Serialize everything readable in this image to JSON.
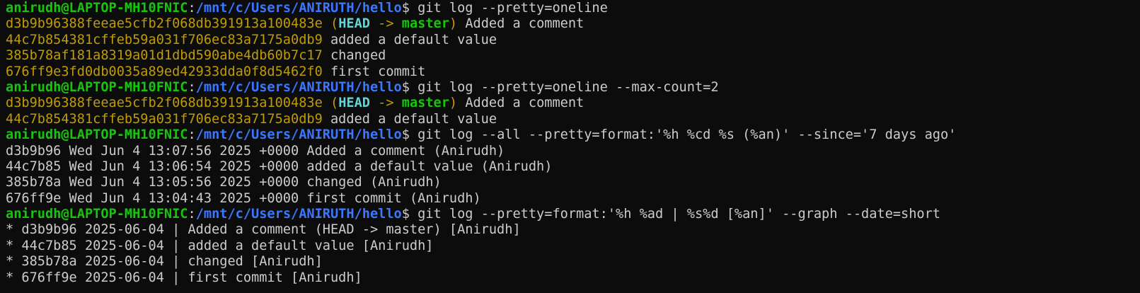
{
  "terminal": {
    "colors": {
      "background": "#0c0c0c",
      "text": "#cccccc",
      "prompt_user": "#16c60c",
      "prompt_path": "#3b78ff",
      "commit_hash": "#c19c00",
      "head_ref": "#61d6d6",
      "branch": "#16c60c"
    },
    "lines": [
      [
        {
          "cls": "user",
          "t": "anirudh@LAPTOP-MH10FNIC"
        },
        {
          "cls": "dollar",
          "t": ":"
        },
        {
          "cls": "path",
          "t": "/mnt/c/Users/ANIRUTH/hello"
        },
        {
          "cls": "dollar",
          "t": "$ "
        },
        {
          "cls": "cmd",
          "t": "git log --pretty=oneline"
        }
      ],
      [
        {
          "cls": "hash",
          "t": "d3b9b96388feeae5cfb2f068db391913a100483e"
        },
        {
          "cls": "text",
          "t": " "
        },
        {
          "cls": "paren",
          "t": "("
        },
        {
          "cls": "head",
          "t": "HEAD"
        },
        {
          "cls": "arrow",
          "t": " -> "
        },
        {
          "cls": "branch",
          "t": "master"
        },
        {
          "cls": "paren",
          "t": ")"
        },
        {
          "cls": "text",
          "t": " Added a comment"
        }
      ],
      [
        {
          "cls": "hash",
          "t": "44c7b854381cffeb59a031f706ec83a7175a0db9"
        },
        {
          "cls": "text",
          "t": " added a default value"
        }
      ],
      [
        {
          "cls": "hash",
          "t": "385b78af181a8319a01d1dbd590abe4db60b7c17"
        },
        {
          "cls": "text",
          "t": " changed"
        }
      ],
      [
        {
          "cls": "hash",
          "t": "676ff9e3fd0db0035a89ed42933dda0f8d5462f0"
        },
        {
          "cls": "text",
          "t": " first commit"
        }
      ],
      [
        {
          "cls": "user",
          "t": "anirudh@LAPTOP-MH10FNIC"
        },
        {
          "cls": "dollar",
          "t": ":"
        },
        {
          "cls": "path",
          "t": "/mnt/c/Users/ANIRUTH/hello"
        },
        {
          "cls": "dollar",
          "t": "$ "
        },
        {
          "cls": "cmd",
          "t": "git log --pretty=oneline --max-count=2"
        }
      ],
      [
        {
          "cls": "hash",
          "t": "d3b9b96388feeae5cfb2f068db391913a100483e"
        },
        {
          "cls": "text",
          "t": " "
        },
        {
          "cls": "paren",
          "t": "("
        },
        {
          "cls": "head",
          "t": "HEAD"
        },
        {
          "cls": "arrow",
          "t": " -> "
        },
        {
          "cls": "branch",
          "t": "master"
        },
        {
          "cls": "paren",
          "t": ")"
        },
        {
          "cls": "text",
          "t": " Added a comment"
        }
      ],
      [
        {
          "cls": "hash",
          "t": "44c7b854381cffeb59a031f706ec83a7175a0db9"
        },
        {
          "cls": "text",
          "t": " added a default value"
        }
      ],
      [
        {
          "cls": "user",
          "t": "anirudh@LAPTOP-MH10FNIC"
        },
        {
          "cls": "dollar",
          "t": ":"
        },
        {
          "cls": "path",
          "t": "/mnt/c/Users/ANIRUTH/hello"
        },
        {
          "cls": "dollar",
          "t": "$ "
        },
        {
          "cls": "cmd",
          "t": "git log --all --pretty=format:'%h %cd %s (%an)' --since='7 days ago'"
        }
      ],
      [
        {
          "cls": "text",
          "t": "d3b9b96 Wed Jun 4 13:07:56 2025 +0000 Added a comment (Anirudh)"
        }
      ],
      [
        {
          "cls": "text",
          "t": "44c7b85 Wed Jun 4 13:06:54 2025 +0000 added a default value (Anirudh)"
        }
      ],
      [
        {
          "cls": "text",
          "t": "385b78a Wed Jun 4 13:05:56 2025 +0000 changed (Anirudh)"
        }
      ],
      [
        {
          "cls": "text",
          "t": "676ff9e Wed Jun 4 13:04:43 2025 +0000 first commit (Anirudh)"
        }
      ],
      [
        {
          "cls": "user",
          "t": "anirudh@LAPTOP-MH10FNIC"
        },
        {
          "cls": "dollar",
          "t": ":"
        },
        {
          "cls": "path",
          "t": "/mnt/c/Users/ANIRUTH/hello"
        },
        {
          "cls": "dollar",
          "t": "$ "
        },
        {
          "cls": "cmd",
          "t": "git log --pretty=format:'%h %ad | %s%d [%an]' --graph --date=short"
        }
      ],
      [
        {
          "cls": "text",
          "t": "* d3b9b96 2025-06-04 | Added a comment (HEAD -> master) [Anirudh]"
        }
      ],
      [
        {
          "cls": "text",
          "t": "* 44c7b85 2025-06-04 | added a default value [Anirudh]"
        }
      ],
      [
        {
          "cls": "text",
          "t": "* 385b78a 2025-06-04 | changed [Anirudh]"
        }
      ],
      [
        {
          "cls": "text",
          "t": "* 676ff9e 2025-06-04 | first commit [Anirudh]"
        }
      ]
    ]
  }
}
